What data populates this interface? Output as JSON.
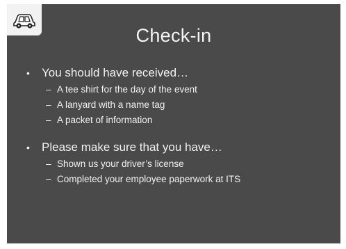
{
  "slide": {
    "title": "Check-in",
    "logo_icon": "car-icon",
    "background_color": "#4a4a4a",
    "text_color": "#f2f2f2",
    "sections": [
      {
        "heading": "You should have received…",
        "items": [
          "A tee shirt for the day of the event",
          "A lanyard with a name tag",
          "A packet of information"
        ]
      },
      {
        "heading": "Please make sure that you have…",
        "items": [
          "Shown us your driver’s license",
          "Completed your employee paperwork at ITS"
        ]
      }
    ]
  }
}
